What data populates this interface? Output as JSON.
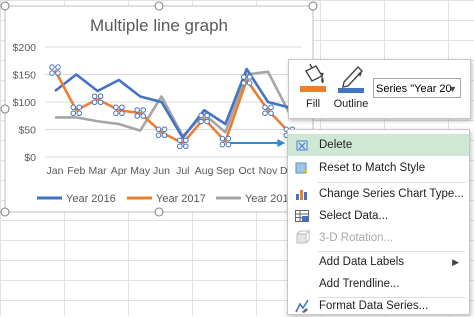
{
  "chart_data": {
    "type": "line",
    "title": "Multiple line graph",
    "categories": [
      "Jan",
      "Feb",
      "Mar",
      "Apr",
      "May",
      "Jun",
      "Jul",
      "Aug",
      "Sep",
      "Oct",
      "Nov",
      "Dec"
    ],
    "yticks": [
      "$0",
      "$50",
      "$100",
      "$150",
      "$200"
    ],
    "ylim": [
      0,
      200
    ],
    "grid": true,
    "legend_position": "bottom",
    "series": [
      {
        "name": "Year 2016",
        "color": "#4472c4",
        "values": [
          120,
          150,
          120,
          140,
          110,
          100,
          35,
          85,
          60,
          160,
          100,
          90
        ]
      },
      {
        "name": "Year 2017",
        "color": "#ed7d31",
        "values": [
          158,
          85,
          105,
          85,
          80,
          45,
          25,
          70,
          28,
          140,
          85,
          45
        ]
      },
      {
        "name": "Year 2018",
        "color": "#a5a5a5",
        "values": [
          72,
          72,
          65,
          60,
          48,
          110,
          38,
          78,
          45,
          150,
          155,
          80
        ]
      }
    ],
    "selected_series": "Year 2017"
  },
  "toolbar": {
    "fill_label": "Fill",
    "outline_label": "Outline",
    "series_select_value": "Series \"Year 20"
  },
  "menu": {
    "items": [
      {
        "label": "Delete",
        "icon": "delete-icon",
        "highlighted": true
      },
      {
        "label": "Reset to Match Style",
        "icon": "reset-style-icon"
      },
      {
        "label": "Change Series Chart Type...",
        "icon": "chart-type-icon"
      },
      {
        "label": "Select Data...",
        "icon": "select-data-icon"
      },
      {
        "label": "3-D Rotation...",
        "icon": "rotation-3d-icon",
        "disabled": true
      },
      {
        "label": "Add Data Labels",
        "icon": "data-labels-icon",
        "submenu": true
      },
      {
        "label": "Add Trendline...",
        "icon": "trendline-icon"
      },
      {
        "label": "Format Data Series...",
        "icon": "format-series-icon"
      }
    ]
  }
}
